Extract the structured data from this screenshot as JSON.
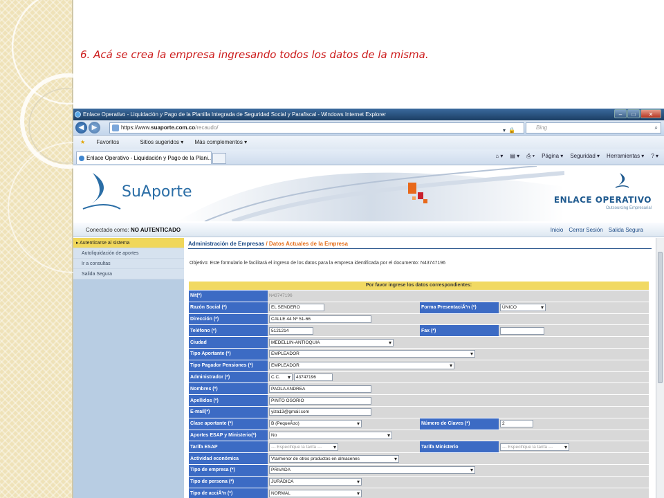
{
  "caption": "6. Acá se crea la empresa ingresando todos los datos de la misma.",
  "browser": {
    "title": "Enlace Operativo - Liquidación y Pago de la Planilla Integrada de Seguridad Social y Parafiscal - Windows Internet Explorer",
    "url_prefix": "https://www.",
    "url_host": "suaporte.com.co",
    "url_path": "/recaudo/",
    "search_placeholder": "Bing",
    "favorites": [
      "Favoritos",
      "Sitios sugeridos ▾",
      "Más complementos ▾"
    ],
    "tab_title": "Enlace Operativo - Liquidación y Pago de la Plani...",
    "commands": [
      "Página ▾",
      "Seguridad ▾",
      "Herramientas ▾"
    ]
  },
  "site": {
    "logo_text": "SuAporte",
    "partner_logo": "ENLACE OPERATIVO",
    "partner_tagline": "Outsourcing Empresarial",
    "connected_label": "Conectado como: ",
    "connected_user": "NO AUTENTICADO",
    "top_links": [
      "Inicio",
      "Cerrar Sesión",
      "Salida Segura"
    ],
    "sidebar": [
      "Autenticarse al sistema",
      "Autoliquidación de aportes",
      "Ir a consultas",
      "Salida Segura"
    ],
    "breadcrumb_root": "Administración de Empresas",
    "breadcrumb_current": " / Datos Actuales de la Empresa",
    "objective": "Objetivo: Este formulario le facilitará el ingreso de los datos para la empresa identificada por el documento: N43747196",
    "form_header": "Por favor ingrese los datos correspondientes:"
  },
  "form": {
    "nit_label": "Nit(*)",
    "nit_value": "N43747196",
    "razon_label": "Razón Social (*)",
    "razon_value": "EL SENDERO",
    "forma_label": "Forma PresentaciÃ³n (*)",
    "forma_value": "ÚNICO",
    "direccion_label": "Dirección (*)",
    "direccion_value": "CALLE 44 Nº 51-66",
    "telefono_label": "Teléfono (*)",
    "telefono_value": "5121214",
    "fax_label": "Fax (*)",
    "fax_value": "",
    "ciudad_label": "Ciudad",
    "ciudad_value": "MEDELLIN-ANTIOQUIA",
    "tipo_aportante_label": "Tipo Aportante (*)",
    "tipo_aportante_value": "EMPLEADOR",
    "tipo_pagador_label": "Tipo Pagador Pensiones (*)",
    "tipo_pagador_value": "EMPLEADOR",
    "administrador_label": "Administrador (*)",
    "admin_doc_type": "C.C.",
    "admin_doc_number": "43747196",
    "nombres_label": "Nombres (*)",
    "nombres_value": "PAOLA ANDREA",
    "apellidos_label": "Apellidos (*)",
    "apellidos_value": "PINTO OSORIO",
    "email_label": "E-mail(*)",
    "email_value": "yiza13@gmail.com",
    "clase_label": "Clase aportante (*)",
    "clase_value": "B (PequeÃ±o)",
    "claves_label": "Número de Claves (*)",
    "claves_value": "2",
    "aportes_label": "Aportes ESAP y Ministerio(*)",
    "aportes_value": "No",
    "tarifa_esap_label": "Tarifa ESAP",
    "tarifa_esap_value": "--- Especifique la tarifa ---",
    "tarifa_min_label": "Tarifa Ministerio",
    "tarifa_min_value": "--- Especifique la tarifa ---",
    "actividad_label": "Actividad económica",
    "actividad_value": "Vta/menor de otros productos en almacenes",
    "tipo_empresa_label": "Tipo de empresa (*)",
    "tipo_empresa_value": "PRIVADA",
    "tipo_persona_label": "Tipo de persona (*)",
    "tipo_persona_value": "JURÃDICA",
    "tipo_accion_label": "Tipo de acciÃ³n (*)",
    "tipo_accion_value": "NORMAL"
  }
}
